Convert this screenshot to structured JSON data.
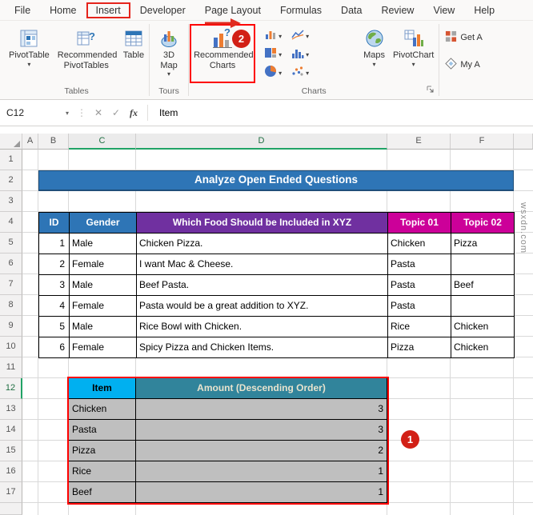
{
  "ribbon_tabs": {
    "items": [
      "File",
      "Home",
      "Insert",
      "Developer",
      "Page Layout",
      "Formulas",
      "Data",
      "Review",
      "View",
      "Help"
    ],
    "active": "Insert"
  },
  "ribbon": {
    "groups": {
      "tables": {
        "label": "Tables",
        "pivottable": "PivotTable",
        "recommended_pivottables": "Recommended PivotTables",
        "table": "Table"
      },
      "tours": {
        "label": "Tours",
        "map3d": "3D Map"
      },
      "charts": {
        "label": "Charts",
        "recommended_charts": "Recommended Charts",
        "maps": "Maps",
        "pivotchart": "PivotChart"
      },
      "addins": {
        "get_addins": "Get A",
        "my_addins": "My A"
      }
    }
  },
  "icons": {
    "dropdown": "▾",
    "cancel": "✕",
    "enter": "✓",
    "dots": "⋮"
  },
  "formula_bar": {
    "name_box": "C12",
    "fx_label": "fx",
    "value": "Item"
  },
  "sheet": {
    "col_headers": [
      "A",
      "B",
      "C",
      "D",
      "E",
      "F"
    ],
    "row_headers": [
      "1",
      "2",
      "3",
      "4",
      "5",
      "6",
      "7",
      "8",
      "9",
      "10",
      "11",
      "12",
      "13",
      "14",
      "15",
      "16",
      "17"
    ],
    "title": "Analyze Open Ended Questions",
    "table1": {
      "headers": [
        "ID",
        "Gender",
        "Which Food Should be Included in XYZ",
        "Topic 01",
        "Topic 02"
      ],
      "rows": [
        [
          "1",
          "Male",
          "Chicken Pizza.",
          "Chicken",
          "Pizza"
        ],
        [
          "2",
          "Female",
          "I want Mac & Cheese.",
          "Pasta",
          ""
        ],
        [
          "3",
          "Male",
          "Beef Pasta.",
          "Pasta",
          "Beef"
        ],
        [
          "4",
          "Female",
          "Pasta would be a great addition to XYZ.",
          "Pasta",
          ""
        ],
        [
          "5",
          "Male",
          "Rice Bowl with Chicken.",
          "Rice",
          "Chicken"
        ],
        [
          "6",
          "Female",
          "Spicy Pizza and Chicken Items.",
          "Pizza",
          "Chicken"
        ]
      ]
    },
    "table2": {
      "headers": [
        "Item",
        "Amount (Descending Order)"
      ],
      "rows": [
        [
          "Chicken",
          "3"
        ],
        [
          "Pasta",
          "3"
        ],
        [
          "Pizza",
          "2"
        ],
        [
          "Rice",
          "1"
        ],
        [
          "Beef",
          "1"
        ]
      ]
    }
  },
  "annotations": {
    "badge1": "1",
    "badge2": "2"
  },
  "watermark": "wsxdn.com",
  "colors": {
    "title_bg": "#2E75B6",
    "header_blue": "#2E75B6",
    "header_purple": "#7030A0",
    "header_magenta": "#CC0099",
    "item_header_bg": "#00B0F0",
    "amount_header_bg": "#31849B",
    "table2_cell_bg": "#BFBFBF",
    "annotation_red": "#FE0000",
    "selection_green": "#21A366"
  }
}
